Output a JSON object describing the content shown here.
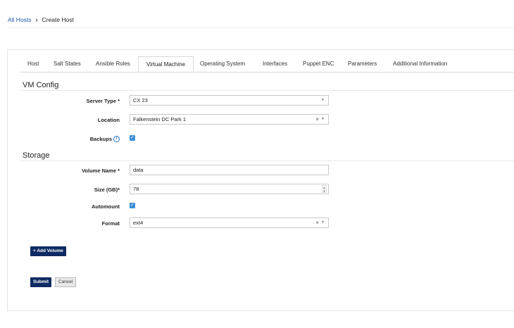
{
  "breadcrumb": {
    "parent": "All Hosts",
    "separator": "›",
    "current": "Create Host"
  },
  "tabs": [
    {
      "label": "Host"
    },
    {
      "label": "Salt States"
    },
    {
      "label": "Ansible Roles"
    },
    {
      "label": "Virtual Machine",
      "active": true
    },
    {
      "label": "Operating System"
    },
    {
      "label": "Interfaces"
    },
    {
      "label": "Puppet ENC"
    },
    {
      "label": "Parameters"
    },
    {
      "label": "Additional Information"
    }
  ],
  "vm_config": {
    "title": "VM Config",
    "server_type": {
      "label": "Server Type *",
      "value": "CX 23"
    },
    "location": {
      "label": "Location",
      "value": "Falkenstein DC Park 1"
    },
    "backups": {
      "label": "Backups",
      "checked": true
    }
  },
  "storage": {
    "title": "Storage",
    "volume_name": {
      "label": "Volume Name *",
      "value": "data"
    },
    "size": {
      "label": "Size (GB)*",
      "value": "78"
    },
    "automount": {
      "label": "Automount",
      "checked": true
    },
    "format": {
      "label": "Format",
      "value": "ext4"
    }
  },
  "buttons": {
    "add_volume": "+ Add Volume",
    "submit": "Submit",
    "cancel": "Cancel"
  },
  "icons": {
    "check": "✓",
    "caret": "▼",
    "clear": "×",
    "info": "i",
    "spin_up": "▲",
    "spin_down": "▼"
  },
  "colors": {
    "link": "#1e5aa8",
    "primary": "#0f2b63",
    "checkbox": "#3b8fd6"
  }
}
